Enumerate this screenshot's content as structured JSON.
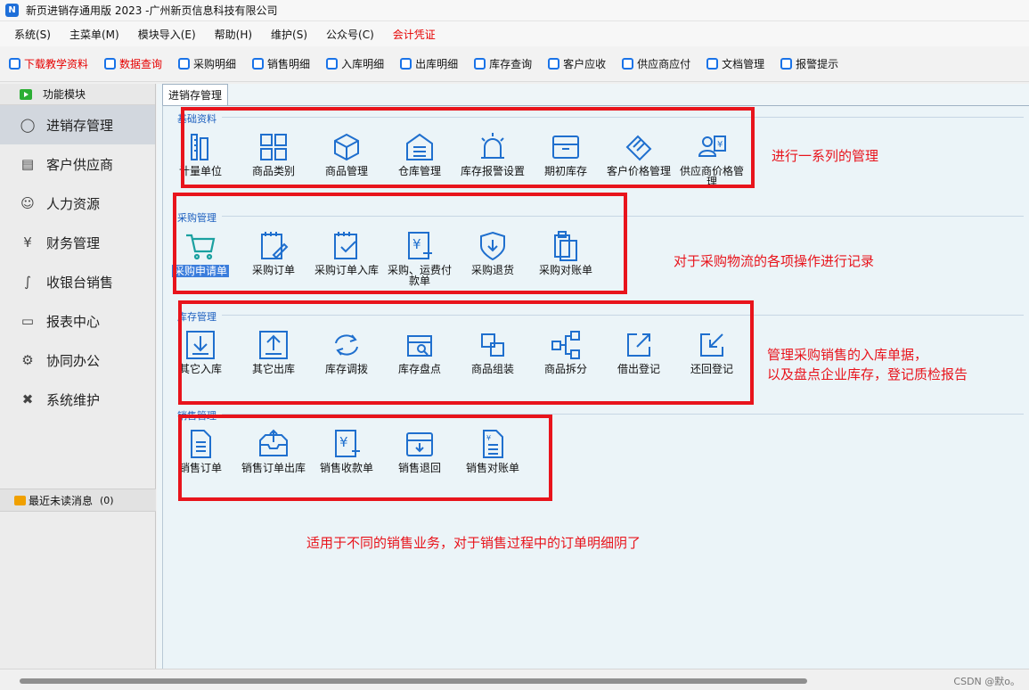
{
  "window": {
    "title": "新页进销存通用版 2023 -广州新页信息科技有限公司",
    "app_icon": "N"
  },
  "menu": [
    {
      "label": "系统(S)"
    },
    {
      "label": "主菜单(M)"
    },
    {
      "label": "模块导入(E)"
    },
    {
      "label": "帮助(H)"
    },
    {
      "label": "维护(S)"
    },
    {
      "label": "公众号(C)"
    },
    {
      "label": "会计凭证",
      "color": "#e60000"
    }
  ],
  "toolbar": [
    {
      "label": "下载教学资料",
      "color": "#e60000"
    },
    {
      "label": "数据查询",
      "color": "#e60000"
    },
    {
      "label": "采购明细"
    },
    {
      "label": "销售明细"
    },
    {
      "label": "入库明细"
    },
    {
      "label": "出库明细"
    },
    {
      "label": "库存查询"
    },
    {
      "label": "客户应收"
    },
    {
      "label": "供应商应付"
    },
    {
      "label": "文档管理"
    },
    {
      "label": "报警提示"
    }
  ],
  "sidebar": {
    "header": "功能模块",
    "items": [
      {
        "label": "进销存管理",
        "icon": "inventory-icon",
        "active": true
      },
      {
        "label": "客户供应商",
        "icon": "contacts-icon"
      },
      {
        "label": "人力资源",
        "icon": "person-icon"
      },
      {
        "label": "财务管理",
        "icon": "money-icon"
      },
      {
        "label": "收银台销售",
        "icon": "chart-icon"
      },
      {
        "label": "报表中心",
        "icon": "monitor-icon"
      },
      {
        "label": "协同办公",
        "icon": "settings-icon"
      },
      {
        "label": "系统维护",
        "icon": "tools-icon"
      }
    ],
    "messages": {
      "label": "最近未读消息",
      "count": "(0)"
    }
  },
  "tab": {
    "label": "进销存管理"
  },
  "groups": [
    {
      "label": "基础资料",
      "items": [
        {
          "label": "计量单位",
          "icon": "ruler-icon"
        },
        {
          "label": "商品类别",
          "icon": "grid-icon"
        },
        {
          "label": "商品管理",
          "icon": "box-icon"
        },
        {
          "label": "仓库管理",
          "icon": "warehouse-icon"
        },
        {
          "label": "库存报警设置",
          "icon": "alarm-icon"
        },
        {
          "label": "期初库存",
          "icon": "archive-icon"
        },
        {
          "label": "客户价格管理",
          "icon": "tag-icon"
        },
        {
          "label": "供应商价格管理",
          "icon": "supplier-price-icon"
        }
      ]
    },
    {
      "label": "采购管理",
      "items": [
        {
          "label": "采购申请单",
          "icon": "cart-icon",
          "selected": true
        },
        {
          "label": "采购订单",
          "icon": "edit-doc-icon"
        },
        {
          "label": "采购订单入库",
          "icon": "check-doc-icon"
        },
        {
          "label": "采购、运费付款单",
          "icon": "yen-doc-icon"
        },
        {
          "label": "采购退货",
          "icon": "shield-down-icon"
        },
        {
          "label": "采购对账单",
          "icon": "clipboard-icon"
        }
      ]
    },
    {
      "label": "库存管理",
      "items": [
        {
          "label": "其它入库",
          "icon": "download-icon"
        },
        {
          "label": "其它出库",
          "icon": "upload-icon"
        },
        {
          "label": "库存调拨",
          "icon": "transfer-icon"
        },
        {
          "label": "库存盘点",
          "icon": "stocktake-icon"
        },
        {
          "label": "商品组装",
          "icon": "assemble-icon"
        },
        {
          "label": "商品拆分",
          "icon": "split-icon"
        },
        {
          "label": "借出登记",
          "icon": "lend-icon"
        },
        {
          "label": "还回登记",
          "icon": "return-icon"
        }
      ]
    },
    {
      "label": "销售管理",
      "items": [
        {
          "label": "销售订单",
          "icon": "doc-icon"
        },
        {
          "label": "销售订单出库",
          "icon": "outbox-icon"
        },
        {
          "label": "销售收款单",
          "icon": "yen-receipt-icon"
        },
        {
          "label": "销售退回",
          "icon": "archive-down-icon"
        },
        {
          "label": "销售对账单",
          "icon": "yen-list-icon"
        }
      ]
    }
  ],
  "annotations": [
    {
      "text": "进行一系列的管理"
    },
    {
      "text": "对于采购物流的各项操作进行记录"
    },
    {
      "text": "管理采购销售的入库单据，"
    },
    {
      "text": "以及盘点企业库存，登记质检报告"
    },
    {
      "text": "适用于不同的销售业务，对于销售过程中的订单明细阴了"
    }
  ],
  "watermark": "CSDN @默o。",
  "colors": {
    "accent": "#1a73e8",
    "annotation": "#e8141c",
    "icon": "#1f6fce"
  }
}
